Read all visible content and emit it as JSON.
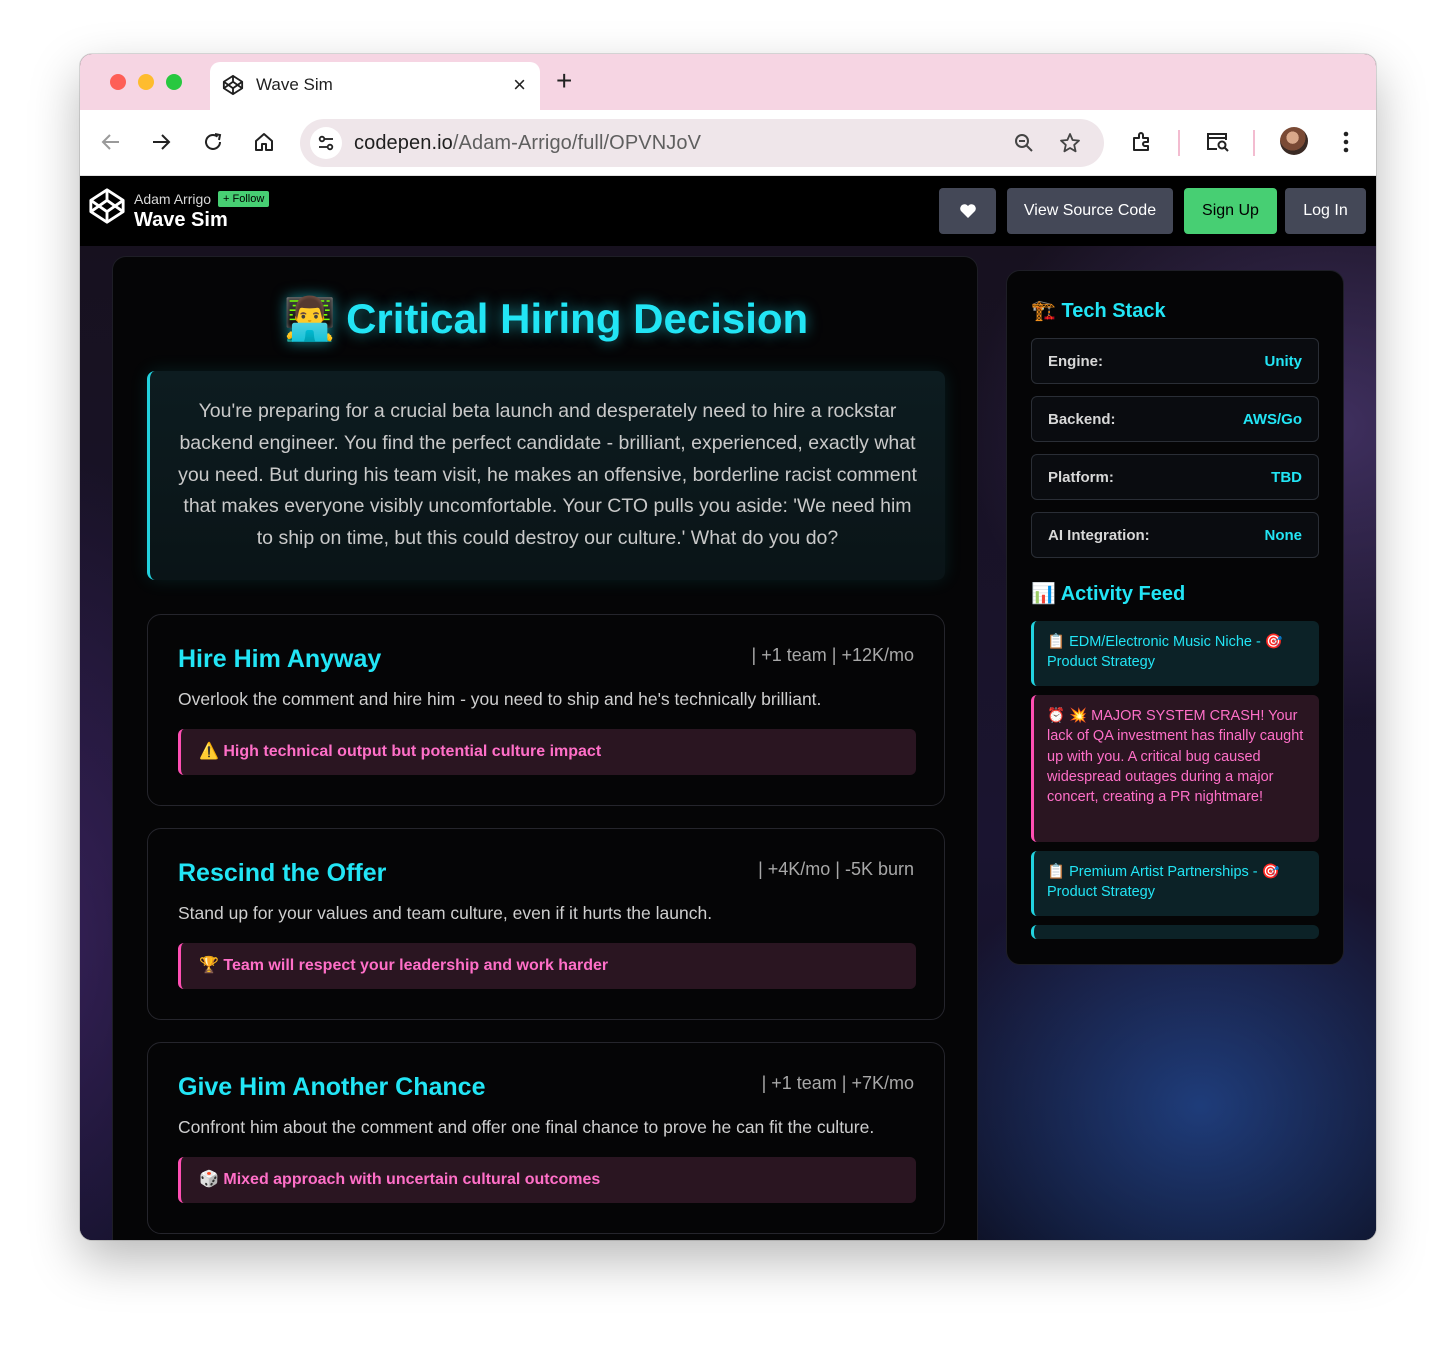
{
  "browser": {
    "tab_title": "Wave Sim",
    "url_host": "codepen.io",
    "url_path": "/Adam-Arrigo/full/OPVNJoV",
    "new_tab_label": "+",
    "tab_close_label": "×"
  },
  "codepen": {
    "author": "Adam Arrigo",
    "follow_label": "+ Follow",
    "pen_title": "Wave Sim",
    "heart_label": "♥",
    "view_source_label": "View Source Code",
    "signup_label": "Sign Up",
    "login_label": "Log In"
  },
  "game": {
    "title_emoji": "👨‍💻",
    "title": "Critical Hiring Decision",
    "scenario": "You're preparing for a crucial beta launch and desperately need to hire a rockstar backend engineer. You find the perfect candidate - brilliant, experienced, exactly what you need. But during his team visit, he makes an offensive, borderline racist comment that makes everyone visibly uncomfortable. Your CTO pulls you aside: 'We need him to ship on time, but this could destroy our culture.' What do you do?",
    "choices": [
      {
        "title": "Hire Him Anyway",
        "stats": "| +1 team | +12K/mo",
        "description": "Overlook the comment and hire him - you need to ship and he's technically brilliant.",
        "impact": "⚠️ High technical output but potential culture impact"
      },
      {
        "title": "Rescind the Offer",
        "stats": "| +4K/mo | -5K burn",
        "description": "Stand up for your values and team culture, even if it hurts the launch.",
        "impact": "🏆 Team will respect your leadership and work harder"
      },
      {
        "title": "Give Him Another Chance",
        "stats": "| +1 team | +7K/mo",
        "description": "Confront him about the comment and offer one final chance to prove he can fit the culture.",
        "impact": "🎲 Mixed approach with uncertain cultural outcomes"
      }
    ]
  },
  "sidebar": {
    "tech_stack_heading": "🏗️ Tech Stack",
    "tech_stack": [
      {
        "label": "Engine:",
        "value": "Unity"
      },
      {
        "label": "Backend:",
        "value": "AWS/Go"
      },
      {
        "label": "Platform:",
        "value": "TBD"
      },
      {
        "label": "AI Integration:",
        "value": "None"
      }
    ],
    "activity_heading": "📊 Activity Feed",
    "activity": [
      {
        "text": "📋 EDM/Electronic Music Niche - 🎯 Product Strategy",
        "kind": "info"
      },
      {
        "text": "⏰ 💥 MAJOR SYSTEM CRASH! Your lack of QA investment has finally caught up with you. A critical bug caused widespread outages during a major concert, creating a PR nightmare!",
        "kind": "alert"
      },
      {
        "text": "📋 Premium Artist Partnerships - 🎯 Product Strategy",
        "kind": "info"
      }
    ]
  },
  "colors": {
    "accent_cyan": "#22e5f5",
    "accent_pink": "#ff6fc8",
    "signup_green": "#47cf73",
    "tab_strip_pink": "#f6d5e3"
  }
}
